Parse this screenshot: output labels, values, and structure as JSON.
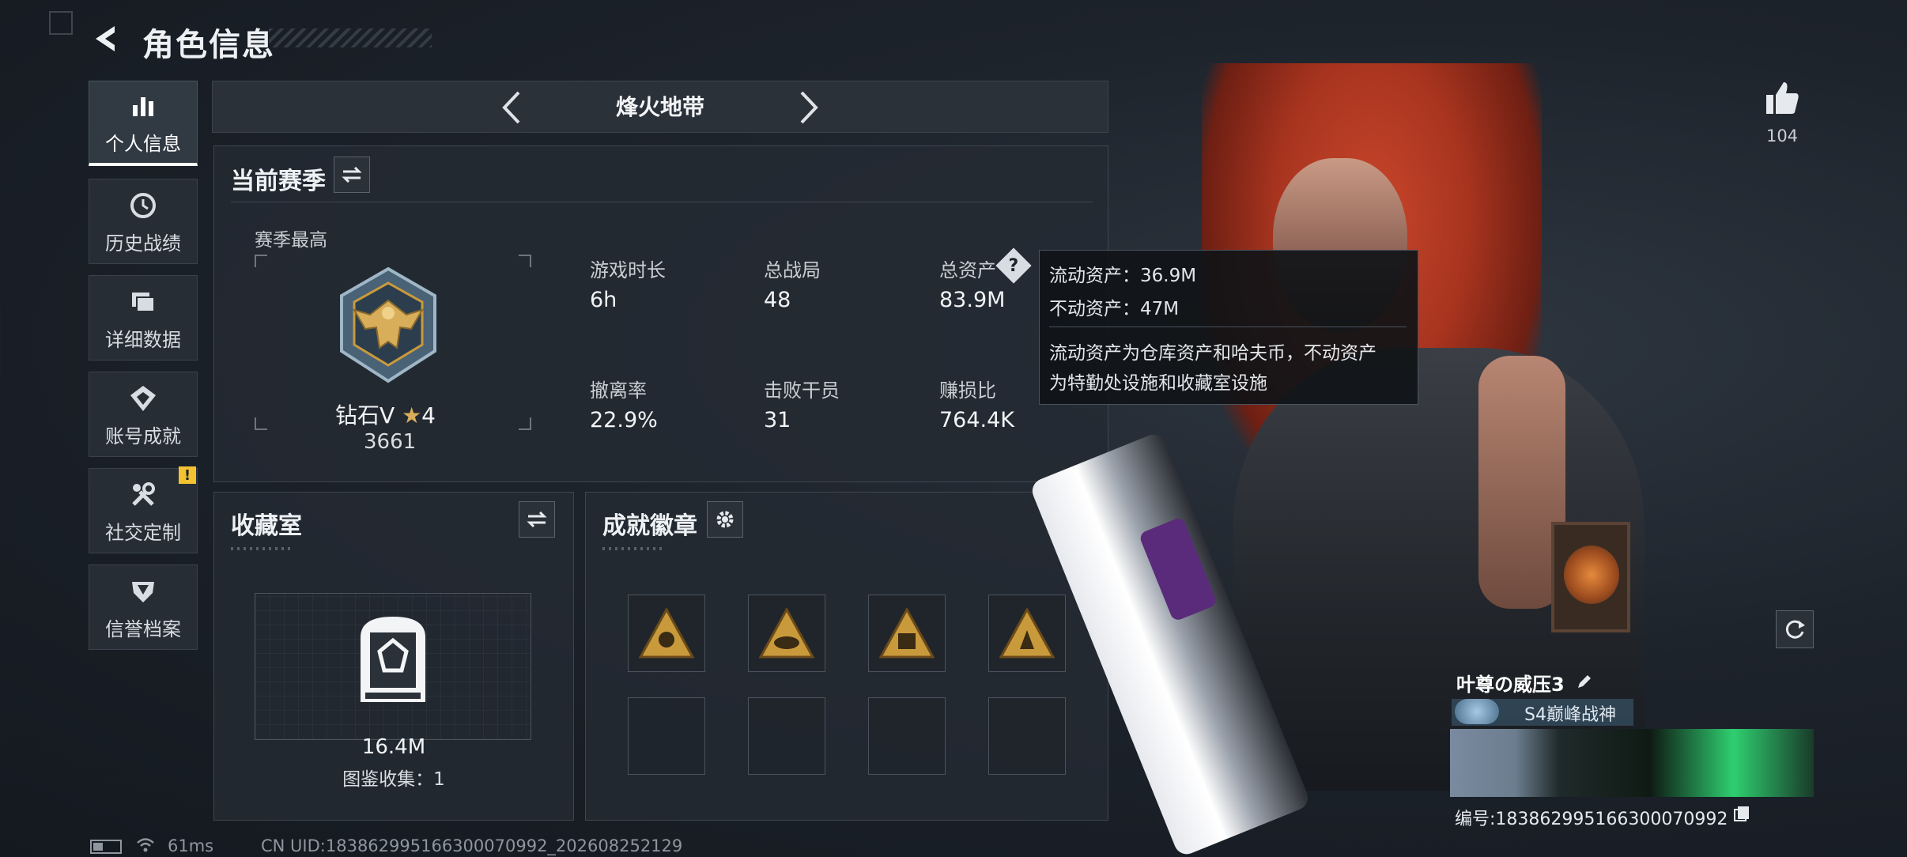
{
  "header": {
    "title": "角色信息"
  },
  "sidebar": {
    "items": [
      {
        "label": "个人信息",
        "icon": "bar-chart-icon",
        "active": true
      },
      {
        "label": "历史战绩",
        "icon": "history-clock-icon",
        "active": false
      },
      {
        "label": "详细数据",
        "icon": "folder-icon",
        "active": false
      },
      {
        "label": "账号成就",
        "icon": "achievement-icon",
        "active": false
      },
      {
        "label": "社交定制",
        "icon": "tools-icon",
        "active": false,
        "badge": "!"
      },
      {
        "label": "信誉档案",
        "icon": "shield-icon",
        "active": false
      }
    ]
  },
  "mode": {
    "name": "烽火地带"
  },
  "season": {
    "title": "当前赛季",
    "highest_label": "赛季最高",
    "rank_name": "钻石V",
    "rank_stars": "4",
    "rank_score": "3661",
    "stats": [
      {
        "label": "游戏时长",
        "value": "6h"
      },
      {
        "label": "总战局",
        "value": "48"
      },
      {
        "label": "总资产",
        "value": "83.9M",
        "help": "?"
      },
      {
        "label": "撤离率",
        "value": "22.9%"
      },
      {
        "label": "击败干员",
        "value": "31"
      },
      {
        "label": "赚损比",
        "value": "764.4K"
      }
    ]
  },
  "tooltip": {
    "liquid": "流动资产：36.9M",
    "fixed": "不动资产：47M",
    "desc_line1": "流动资产为仓库资产和哈夫币，不动资产",
    "desc_line2": "为特勤处设施和收藏室设施"
  },
  "collection": {
    "title": "收藏室",
    "value": "16.4M",
    "sub": "图鉴收集：1"
  },
  "badges": {
    "title": "成就徽章",
    "filled_count": 4,
    "empty_count": 4,
    "color": "#c99a3c"
  },
  "player": {
    "like_count": "104",
    "name": "叶尊の威压3",
    "title": "S4巅峰战神",
    "uid_line": "编号:183862995166300070992"
  },
  "status": {
    "ping": "61ms",
    "uid": "CN UID:183862995166300070992_202608252129"
  },
  "colors": {
    "accent_badge": "#f2c230",
    "panel_bg": "#242a32",
    "border": "#3d4650"
  }
}
